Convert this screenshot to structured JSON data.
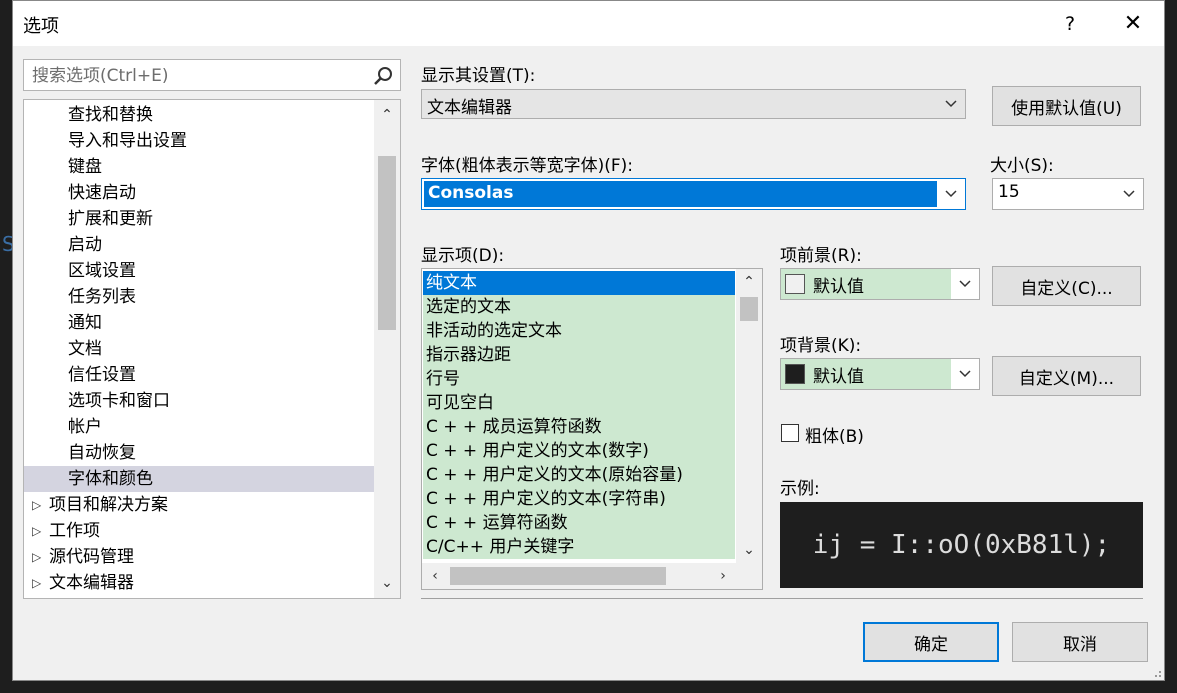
{
  "dialog": {
    "title": "选项",
    "help": "?",
    "close": "✕"
  },
  "search": {
    "placeholder": "搜索选项(Ctrl+E)"
  },
  "tree": {
    "items": [
      {
        "label": "查找和替换",
        "level": 1
      },
      {
        "label": "导入和导出设置",
        "level": 1
      },
      {
        "label": "键盘",
        "level": 1
      },
      {
        "label": "快速启动",
        "level": 1
      },
      {
        "label": "扩展和更新",
        "level": 1
      },
      {
        "label": "启动",
        "level": 1
      },
      {
        "label": "区域设置",
        "level": 1
      },
      {
        "label": "任务列表",
        "level": 1
      },
      {
        "label": "通知",
        "level": 1
      },
      {
        "label": "文档",
        "level": 1
      },
      {
        "label": "信任设置",
        "level": 1
      },
      {
        "label": "选项卡和窗口",
        "level": 1
      },
      {
        "label": "帐户",
        "level": 1
      },
      {
        "label": "自动恢复",
        "level": 1
      },
      {
        "label": "字体和颜色",
        "level": 1,
        "selected": true
      },
      {
        "label": "项目和解决方案",
        "level": 0
      },
      {
        "label": "工作项",
        "level": 0
      },
      {
        "label": "源代码管理",
        "level": 0
      },
      {
        "label": "文本编辑器",
        "level": 0
      }
    ]
  },
  "show_settings": {
    "label": "显示其设置(T):",
    "value": "文本编辑器",
    "default_button": "使用默认值(U)"
  },
  "font": {
    "label": "字体(粗体表示等宽字体)(F):",
    "value": "Consolas"
  },
  "size": {
    "label": "大小(S):",
    "value": "15"
  },
  "display_items": {
    "label": "显示项(D):",
    "items": [
      "纯文本",
      "选定的文本",
      "非活动的选定文本",
      "指示器边距",
      "行号",
      "可见空白",
      "C + + 成员运算符函数",
      "C + + 用户定义的文本(数字)",
      "C + + 用户定义的文本(原始容量)",
      "C + + 用户定义的文本(字符串)",
      "C + + 运算符函数",
      "C/C++ 用户关键字"
    ],
    "selected_index": 0
  },
  "foreground": {
    "label": "项前景(R):",
    "value": "默认值",
    "swatch_color": "#f0f0f0",
    "custom_button": "自定义(C)..."
  },
  "background": {
    "label": "项背景(K):",
    "value": "默认值",
    "swatch_color": "#1e1e1e",
    "custom_button": "自定义(M)..."
  },
  "bold": {
    "label": "粗体(B)",
    "checked": false
  },
  "sample": {
    "label": "示例:",
    "text": "ij = I::oO(0xB81l);"
  },
  "footer": {
    "ok": "确定",
    "cancel": "取消"
  },
  "colors": {
    "accent": "#0078d7",
    "list_item_bg": "#cde8d0",
    "sample_bg": "#1e1e1e"
  }
}
